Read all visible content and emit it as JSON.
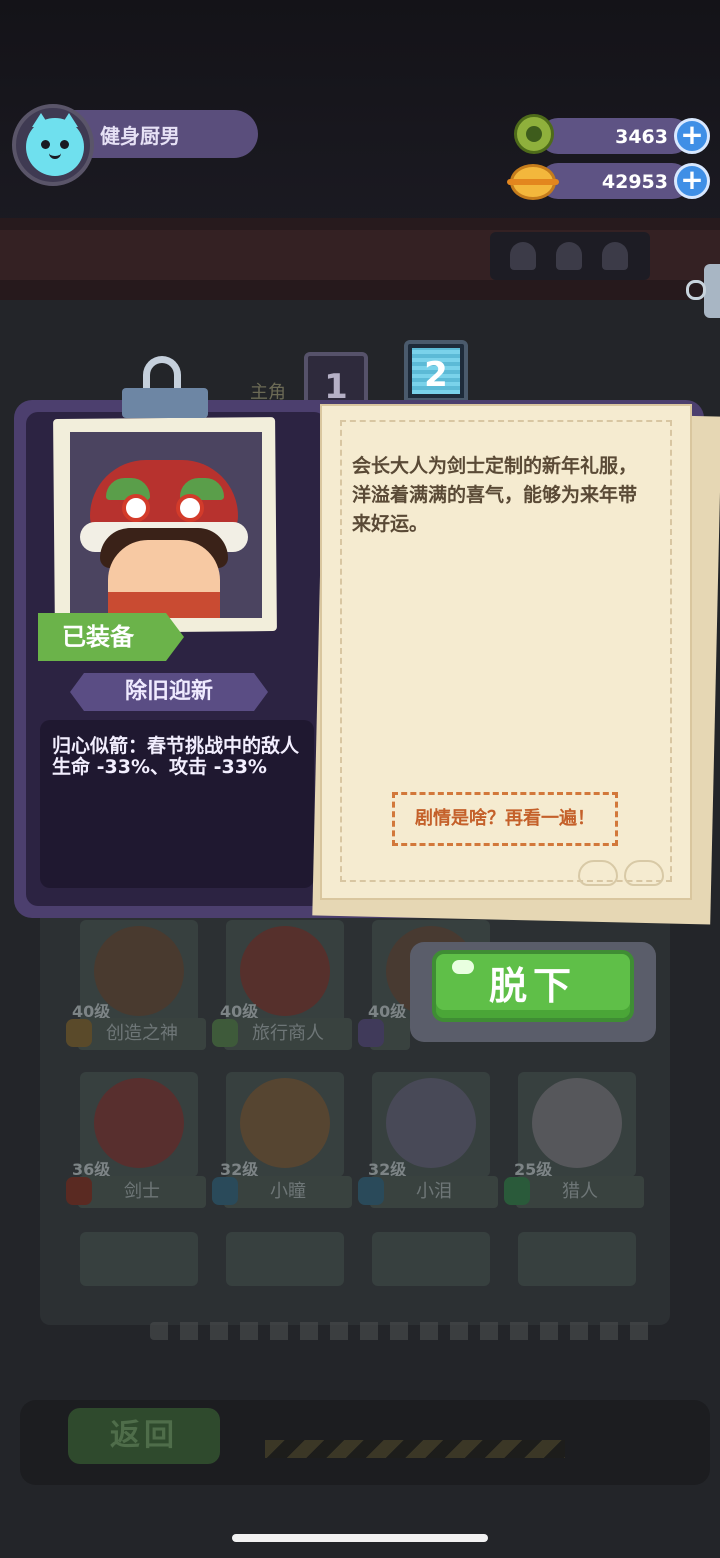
{
  "hud": {
    "player_name": "健身厨男",
    "gems": "3463",
    "coins": "42953",
    "plus": "+"
  },
  "modal": {
    "tabs": [
      "1",
      "2"
    ],
    "active_tab": "2",
    "equipped_label": "已装备",
    "costume_name": "除旧迎新",
    "skill_text": "归心似箭：春节挑战中的敌人生命 -33%、攻击 -33%",
    "description": "会长大人为剑士定制的新年礼服，洋溢着满满的喜气，能够为来年带来好运。",
    "story_button": "剧情是啥？再看一遍！",
    "take_off_button": "脱下"
  },
  "background": {
    "partial_label": "主角",
    "characters": [
      {
        "level": "40级",
        "name": "创造之神"
      },
      {
        "level": "40级",
        "name": "旅行商人"
      },
      {
        "level": "40级",
        "name": ""
      },
      {
        "level": "36级",
        "name": "剑士"
      },
      {
        "level": "32级",
        "name": "小瞳"
      },
      {
        "level": "32级",
        "name": "小泪"
      },
      {
        "level": "25级",
        "name": "猎人"
      }
    ],
    "back_button": "返回"
  },
  "colors": {
    "modal_purple": "#4c3f6e",
    "equip_green": "#6bb34a",
    "button_green": "#5fbf48",
    "paper": "#f5ebd0",
    "story_orange": "#c4602a"
  }
}
